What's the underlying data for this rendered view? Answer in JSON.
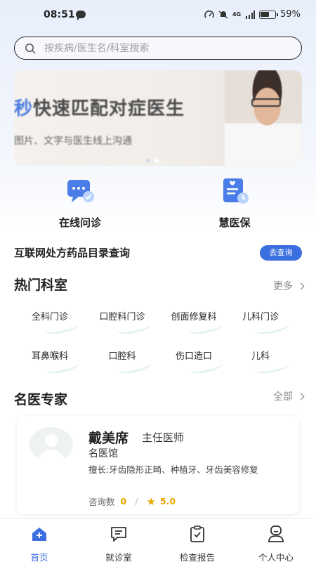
{
  "status_bar": {
    "time": "08:51",
    "network": "4G",
    "battery": "59%"
  },
  "search": {
    "placeholder": "按疾病/医生名/科室搜索"
  },
  "banner": {
    "title_accent": "秒",
    "title": "快速匹配对症医生",
    "subtitle": "图片、文字与医生线上沟通"
  },
  "services": [
    {
      "label": "在线问诊",
      "icon": "chat-bubble-icon"
    },
    {
      "label": "慧医保",
      "icon": "insurance-card-icon"
    }
  ],
  "catalog": {
    "title": "互联网处方药品目录查询",
    "button": "去查询"
  },
  "departments": {
    "title": "热门科室",
    "more": "更多",
    "items": [
      "全科门诊",
      "口腔科门诊",
      "创面修复科",
      "儿科门诊",
      "耳鼻喉科",
      "口腔科",
      "伤口造口",
      "儿科"
    ]
  },
  "experts": {
    "title": "名医专家",
    "more": "全部",
    "doctor": {
      "name": "戴美席",
      "title": "主任医师",
      "hospital": "名医馆",
      "skill": "擅长:牙齿隐形正畸、种植牙、牙齿美容修复",
      "consult_label": "咨询数",
      "consult_count": "0",
      "rating": "5.0"
    }
  },
  "bottom_nav": [
    {
      "label": "首页",
      "icon": "home-icon",
      "active": true
    },
    {
      "label": "就诊室",
      "icon": "message-icon",
      "active": false
    },
    {
      "label": "检查报告",
      "icon": "clipboard-icon",
      "active": false
    },
    {
      "label": "个人中心",
      "icon": "person-icon",
      "active": false
    }
  ],
  "colors": {
    "primary": "#3b6fe0",
    "rating": "#e8a600",
    "background": "#f3f6fc"
  }
}
